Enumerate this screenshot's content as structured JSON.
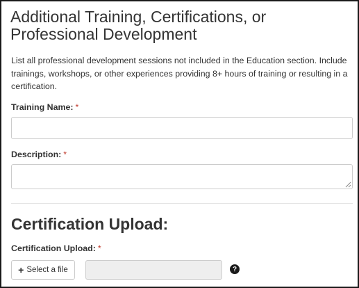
{
  "training_section": {
    "title": "Additional Training, Certifications, or Professional Development",
    "help_text": "List all professional development sessions not included in the Education section. Include trainings, workshops, or other experiences providing 8+ hours of training or resulting in a certification.",
    "training_name": {
      "label": "Training Name:",
      "required_mark": "*",
      "value": ""
    },
    "description": {
      "label": "Description:",
      "required_mark": "*",
      "value": ""
    }
  },
  "certification_section": {
    "title": "Certification Upload:",
    "upload": {
      "label": "Certification Upload:",
      "required_mark": "*",
      "button_label": "Select a file",
      "button_icon": "plus-icon",
      "file_name": "",
      "help_icon": "question-circle-icon"
    }
  },
  "colors": {
    "required": "#c0392b",
    "border": "#cccccc",
    "disabled_fill": "#eeeeee"
  }
}
